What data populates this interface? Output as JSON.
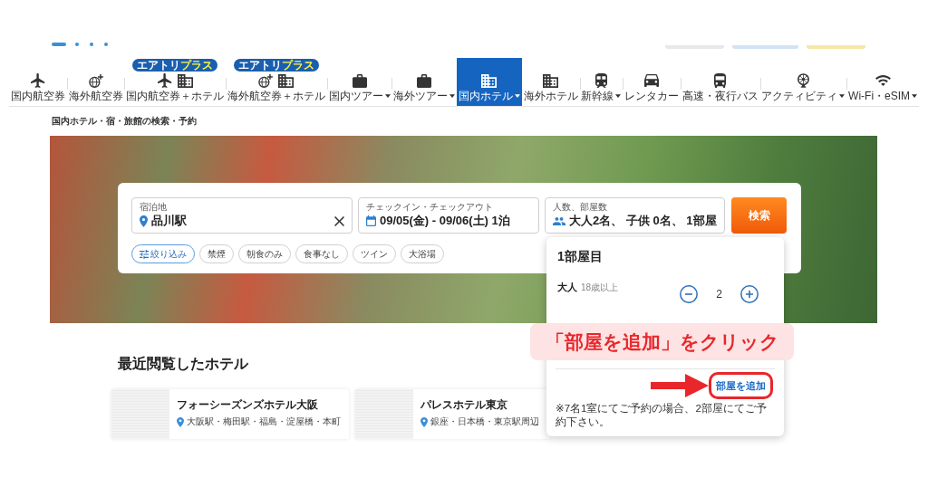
{
  "header_buttons": [
    {
      "color": "#e6e8eb"
    },
    {
      "color": "#d3e3f4"
    },
    {
      "color": "#f6e7a6"
    }
  ],
  "nav": [
    {
      "label": "国内航空券",
      "selected": false,
      "dropdown": false
    },
    {
      "label": "海外航空券",
      "selected": false,
      "dropdown": false
    },
    {
      "label": "国内航空券＋ホテル",
      "selected": false,
      "dropdown": false,
      "badge": {
        "text": "エアトリ",
        "accent": "プラス"
      }
    },
    {
      "label": "海外航空券＋ホテル",
      "selected": false,
      "dropdown": false,
      "badge": {
        "text": "エアトリ",
        "accent": "プラス"
      }
    },
    {
      "label": "国内ツアー",
      "selected": false,
      "dropdown": true
    },
    {
      "label": "海外ツアー",
      "selected": false,
      "dropdown": true
    },
    {
      "label": "国内ホテル",
      "selected": true,
      "dropdown": true
    },
    {
      "label": "海外ホテル",
      "selected": false,
      "dropdown": false
    },
    {
      "label": "新幹線",
      "selected": false,
      "dropdown": true
    },
    {
      "label": "レンタカー",
      "selected": false,
      "dropdown": false
    },
    {
      "label": "高速・夜行バス",
      "selected": false,
      "dropdown": false
    },
    {
      "label": "アクティビティ",
      "selected": false,
      "dropdown": true
    },
    {
      "label": "Wi-Fi・eSIM",
      "selected": false,
      "dropdown": true
    }
  ],
  "breadcrumb": "国内ホテル・宿・旅館の検索・予約",
  "search": {
    "fields": [
      {
        "kind": "location",
        "label": "宿泊地",
        "value": "品川駅",
        "clearable": true
      },
      {
        "kind": "dates",
        "label": "チェックイン・チェックアウト",
        "value": "09/05(金) - 09/06(土) 1泊",
        "clearable": false
      },
      {
        "kind": "guests",
        "label": "人数、部屋数",
        "value": "大人2名、 子供 0名、 1部屋",
        "clearable": false
      }
    ],
    "button": "検索",
    "filters": [
      {
        "kind": "filter",
        "label": "絞り込み"
      },
      {
        "kind": "chip",
        "label": "禁煙"
      },
      {
        "kind": "chip",
        "label": "朝食のみ"
      },
      {
        "kind": "chip",
        "label": "食事なし"
      },
      {
        "kind": "chip",
        "label": "ツイン"
      },
      {
        "kind": "chip",
        "label": "大浴場"
      }
    ]
  },
  "guests_popup": {
    "room_title": "1部屋目",
    "rows": [
      {
        "label": "大人",
        "hint": "18歳以上",
        "count": "2"
      }
    ],
    "add_room": "部屋を追加",
    "note": "※7名1室にてご予約の場合、2部屋にてご予約下さい。"
  },
  "annotation": {
    "text": "「部屋を追加」をクリック"
  },
  "recent": {
    "title": "最近閲覧したホテル",
    "hotels": [
      {
        "name": "フォーシーズンズホテル大阪",
        "area": "大阪駅・梅田駅・福島・淀屋橋・本町"
      },
      {
        "name": "パレスホテル東京",
        "area": "銀座・日本橋・東京駅周辺"
      }
    ]
  }
}
